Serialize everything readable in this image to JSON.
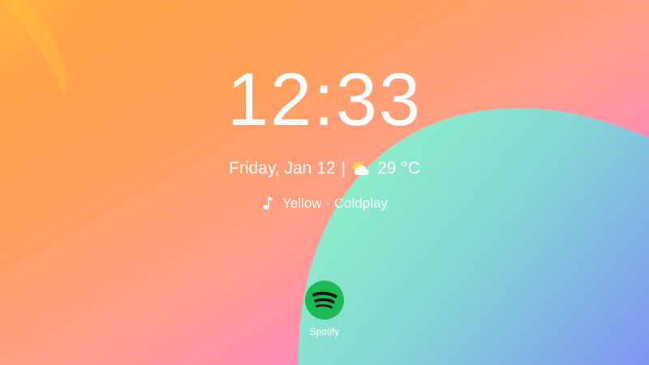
{
  "clock": {
    "time": "12:33"
  },
  "status": {
    "date": "Friday, Jan 12",
    "separator": "|",
    "weather_icon": "partly-cloudy-icon",
    "temperature": "29 °C"
  },
  "now_playing": {
    "icon": "music-note-icon",
    "track": "Yellow - Coldplay"
  },
  "apps": [
    {
      "label": "Spotify",
      "icon": "spotify-icon",
      "color": "#1DB954"
    }
  ]
}
